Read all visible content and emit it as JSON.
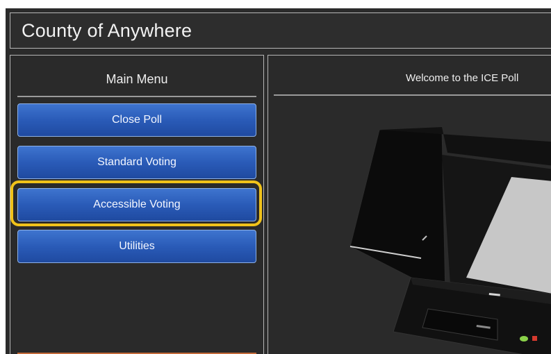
{
  "header": {
    "title": "County of Anywhere"
  },
  "sidebar": {
    "heading": "Main Menu",
    "buttons": [
      {
        "label": "Close Poll"
      },
      {
        "label": "Standard Voting"
      },
      {
        "label": "Accessible Voting",
        "highlighted": true
      },
      {
        "label": "Utilities"
      }
    ]
  },
  "content": {
    "welcome_text": "Welcome to the ICE Poll",
    "image": "voting-machine-illustration"
  },
  "colors": {
    "background": "#2b2b2b",
    "button": "#2a5bb8",
    "highlight": "#f0c21a",
    "border": "#b7b7b7"
  }
}
